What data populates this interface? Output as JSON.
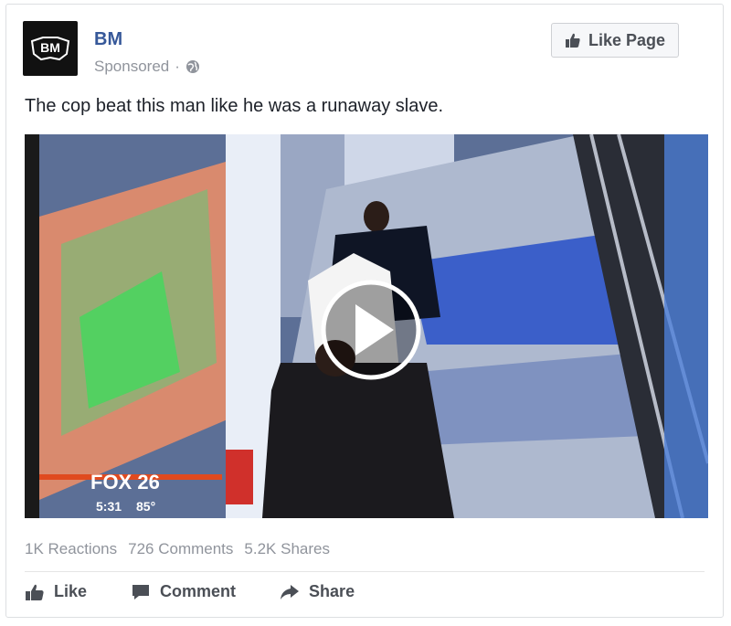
{
  "post": {
    "page_name": "BM",
    "avatar_text": "BM",
    "sponsored_label": "Sponsored",
    "like_page_label": "Like Page",
    "caption": "The cop beat this man like he was a runaway slave."
  },
  "video": {
    "station_logo": "FOX 26",
    "time_overlay": "5:31",
    "temp_overlay": "85°"
  },
  "stats": {
    "reactions": "1K Reactions",
    "comments": "726 Comments",
    "shares": "5.2K Shares"
  },
  "actions": {
    "like": "Like",
    "comment": "Comment",
    "share": "Share"
  },
  "icons": {
    "globe": "globe-icon",
    "thumbs_up": "thumbs-up-icon",
    "comment": "comment-icon",
    "share": "share-icon",
    "play": "play-icon"
  },
  "colors": {
    "link": "#365899",
    "meta": "#90949c",
    "text": "#1d2129"
  }
}
